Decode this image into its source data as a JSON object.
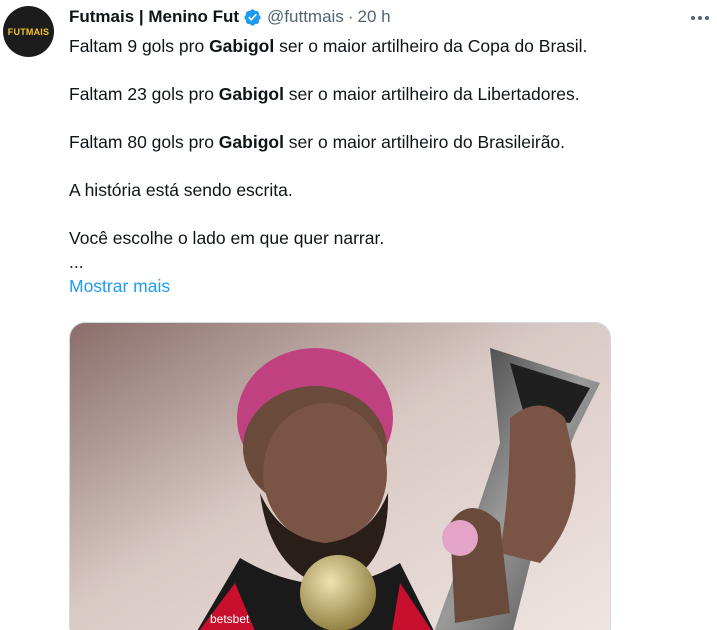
{
  "author": {
    "avatar_text": "FUTMAIS",
    "name": "Futmais | Menino Fut",
    "handle": "@futtmais",
    "separator": "·",
    "time": "20 h"
  },
  "tweet": {
    "lines": [
      {
        "pre": "Faltam 9 gols pro ",
        "bold": "Gabigol",
        "post": " ser o maior artilheiro da Copa do Brasil."
      },
      {
        "pre": "Faltam 23 gols pro ",
        "bold": "Gabigol",
        "post": " ser o maior artilheiro da Libertadores."
      },
      {
        "pre": "Faltam 80 gols pro ",
        "bold": "Gabigol",
        "post": " ser o maior artilheiro do Brasileirão."
      }
    ],
    "statement1": "A história está sendo escrita.",
    "statement2": "Você escolhe o lado em que quer narrar.",
    "ellipsis": "...",
    "show_more": "Mostrar mais"
  },
  "media": {
    "jersey_text": "betsbet"
  },
  "colors": {
    "link": "#1d9bf0",
    "verified": "#1d9bf0",
    "secondary_text": "#536471",
    "hair": "#c0417f",
    "jersey_red": "#c8102e"
  },
  "icons": {
    "verified": "verified-badge-icon",
    "more": "more-options-icon"
  }
}
